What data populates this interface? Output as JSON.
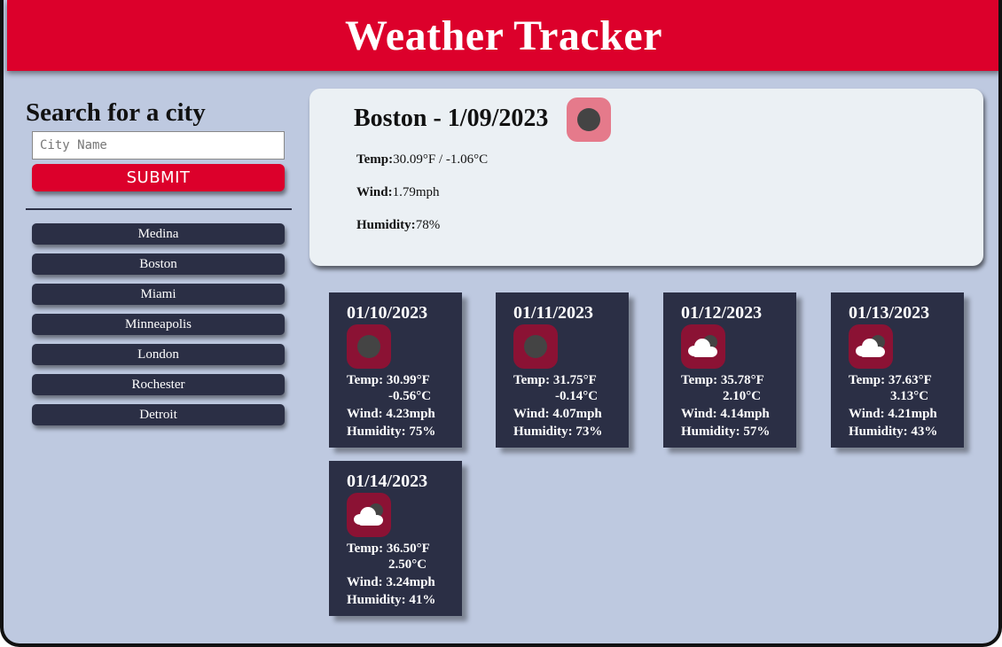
{
  "header": {
    "title": "Weather Tracker"
  },
  "search": {
    "title": "Search for a city",
    "placeholder": "City Name",
    "submit_label": "SUBMIT"
  },
  "history": [
    "Medina",
    "Boston",
    "Miami",
    "Minneapolis",
    "London",
    "Rochester",
    "Detroit"
  ],
  "current": {
    "title": "Boston - 1/09/2023",
    "temp_label": "Temp:",
    "temp_value": "30.09°F / -1.06°C",
    "wind_label": "Wind:",
    "wind_value": "1.79mph",
    "humidity_label": "Humidity:",
    "humidity_value": "78%",
    "icon": "dark-circle-icon"
  },
  "forecast": [
    {
      "date": "01/10/2023",
      "icon": "dark-circle-icon",
      "temp_f": "Temp: 30.99°F",
      "temp_c": "-0.56°C",
      "wind": "Wind: 4.23mph",
      "humidity": "Humidity: 75%"
    },
    {
      "date": "01/11/2023",
      "icon": "dark-circle-icon",
      "temp_f": "Temp: 31.75°F",
      "temp_c": "-0.14°C",
      "wind": "Wind: 4.07mph",
      "humidity": "Humidity: 73%"
    },
    {
      "date": "01/12/2023",
      "icon": "cloud-icon",
      "temp_f": "Temp: 35.78°F",
      "temp_c": "2.10°C",
      "wind": "Wind: 4.14mph",
      "humidity": "Humidity: 57%"
    },
    {
      "date": "01/13/2023",
      "icon": "cloud-icon",
      "temp_f": "Temp: 37.63°F",
      "temp_c": "3.13°C",
      "wind": "Wind: 4.21mph",
      "humidity": "Humidity: 43%"
    },
    {
      "date": "01/14/2023",
      "icon": "cloud-icon",
      "temp_f": "Temp: 36.50°F",
      "temp_c": "2.50°C",
      "wind": "Wind: 3.24mph",
      "humidity": "Humidity: 41%"
    }
  ],
  "colors": {
    "brand_red": "#dc002b",
    "navy": "#2b2f45",
    "background": "#bec9e0",
    "card_light": "#ebf0f4",
    "icon_bg_current": "#e57a8b",
    "icon_bg_forecast": "#8b1234"
  }
}
